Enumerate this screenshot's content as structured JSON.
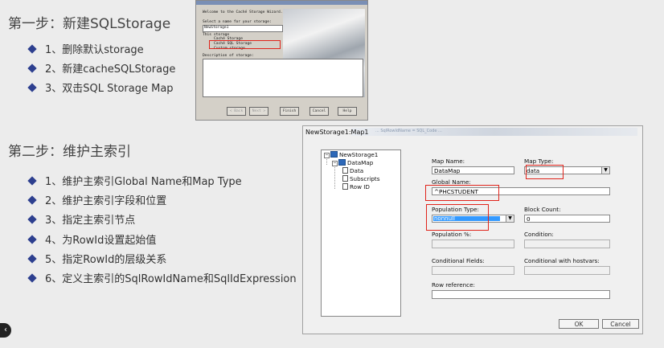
{
  "step1": {
    "title": "第一步：新建SQLStorage",
    "items": [
      "1、删除默认storage",
      "2、新建cacheSQLStorage",
      "3、双击SQL Storage Map"
    ]
  },
  "step2": {
    "title": "第二步：维护主索引",
    "items": [
      "1、维护主索引Global Name和Map Type",
      "2、维护主索引字段和位置",
      "3、指定主索引节点",
      "4、为RowId设置起始值",
      "5、指定RowId的层级关系",
      "6、定义主索引的SqlRowIdName和SqlIdExpression"
    ]
  },
  "nav": {
    "prev_glyph": "‹"
  },
  "wizard": {
    "welcome": "Welcome to the Caché Storage Wizard.",
    "select_prompt": "Select a name for your storage:",
    "name_value": "NewStorage1",
    "this_storage": "This storage",
    "options": [
      "Caché Storage",
      "Caché SQL Storage",
      "Custom storage"
    ],
    "description_label": "Description of storage:",
    "buttons": [
      "< Back",
      "Next >",
      "Finish",
      "Cancel",
      "Help"
    ]
  },
  "dialog": {
    "title": "NewStorage1:Map1",
    "header_blur": "... SqlRowIdName = SQL_Code ...",
    "tree": {
      "root": "NewStorage1",
      "map": "DataMap",
      "children": [
        "Data",
        "Subscripts",
        "Row ID"
      ]
    },
    "fields": {
      "map_name_label": "Map Name:",
      "map_name_value": "DataMap",
      "map_type_label": "Map Type:",
      "map_type_value": "data",
      "global_name_label": "Global Name:",
      "global_name_value": "^PHCSTUDENT",
      "population_type_label": "Population Type:",
      "population_type_value": "nonnull",
      "block_count_label": "Block Count:",
      "block_count_value": "0",
      "population_pct_label": "Population %:",
      "condition_label": "Condition:",
      "conditional_fields_label": "Conditional Fields:",
      "conditional_hostvars_label": "Conditional with hostvars:",
      "row_reference_label": "Row reference:"
    },
    "ok_label": "OK",
    "cancel_label": "Cancel"
  },
  "colors": {
    "bullet": "#2d3f8f",
    "highlight": "#e0241b",
    "selection": "#3399ff"
  }
}
